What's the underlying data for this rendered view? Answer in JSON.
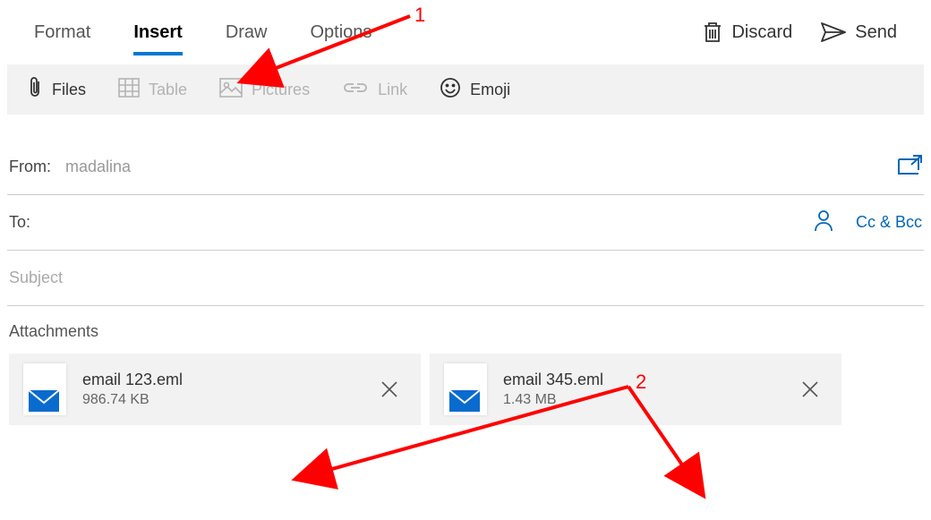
{
  "tabs": {
    "format": "Format",
    "insert": "Insert",
    "draw": "Draw",
    "options": "Options"
  },
  "actions": {
    "discard": "Discard",
    "send": "Send"
  },
  "toolbar": {
    "files": "Files",
    "table": "Table",
    "pictures": "Pictures",
    "link": "Link",
    "emoji": "Emoji"
  },
  "fields": {
    "from_label": "From:",
    "from_value": "madalina",
    "to_label": "To:",
    "ccbcc": "Cc & Bcc",
    "subject_placeholder": "Subject",
    "attachments_label": "Attachments"
  },
  "attachments": [
    {
      "name": "email 123.eml",
      "size": "986.74 KB"
    },
    {
      "name": "email 345.eml",
      "size": "1.43 MB"
    }
  ],
  "annotations": {
    "one": "1",
    "two": "2"
  }
}
